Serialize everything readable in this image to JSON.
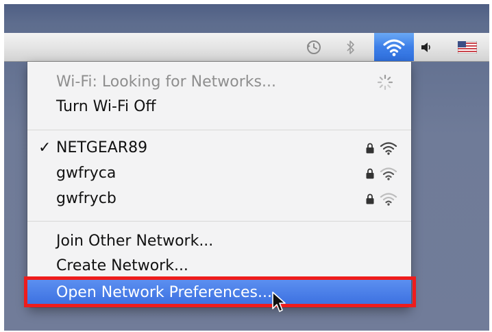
{
  "menubar": {
    "icons": [
      "time-machine-icon",
      "bluetooth-icon",
      "wifi-icon",
      "volume-icon",
      "input-source-flag-icon"
    ],
    "wifi_active_color": "#3d7fe8"
  },
  "wifi_menu": {
    "status_label": "Wi-Fi: Looking for Networks...",
    "toggle_label": "Turn Wi-Fi Off",
    "networks": [
      {
        "name": "NETGEAR89",
        "connected": true,
        "secured": true
      },
      {
        "name": "gwfryca",
        "connected": false,
        "secured": true
      },
      {
        "name": "gwfrycb",
        "connected": false,
        "secured": true
      }
    ],
    "check_mark": "✓",
    "join_other_label": "Join Other Network...",
    "create_network_label": "Create Network...",
    "open_prefs_label": "Open Network Preferences..."
  },
  "annotation": {
    "highlight_color": "#ee1c1c"
  }
}
